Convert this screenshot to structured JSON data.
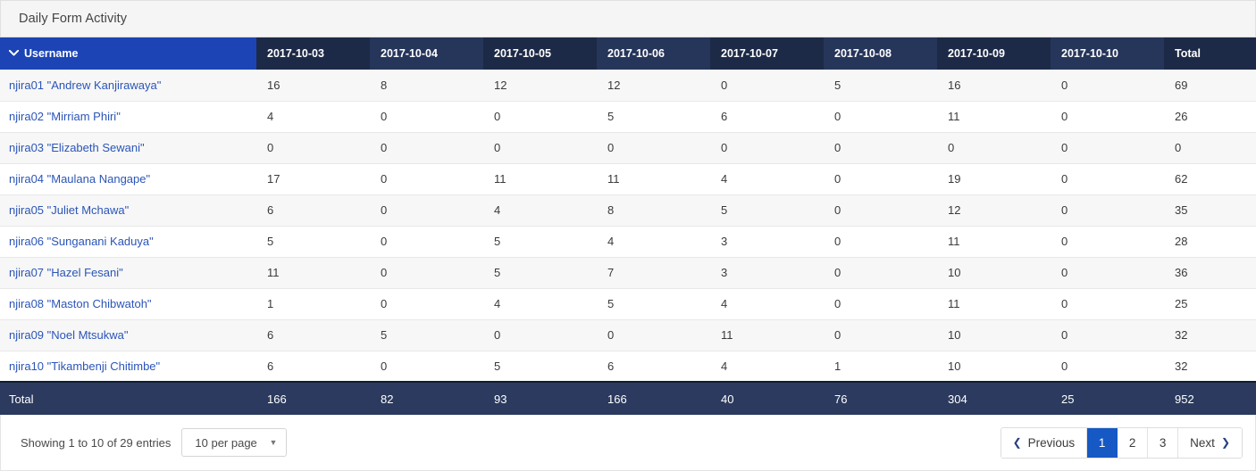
{
  "panel": {
    "title": "Daily Form Activity"
  },
  "table": {
    "username_header": "Username",
    "sort_icon": "chevron-down-icon",
    "sort_caret": "⌄",
    "date_headers": [
      "2017-10-03",
      "2017-10-04",
      "2017-10-05",
      "2017-10-06",
      "2017-10-07",
      "2017-10-08",
      "2017-10-09",
      "2017-10-10"
    ],
    "total_header": "Total",
    "rows": [
      {
        "username": "njira01 \"Andrew Kanjirawaya\"",
        "values": [
          "16",
          "8",
          "12",
          "12",
          "0",
          "5",
          "16",
          "0"
        ],
        "total": "69"
      },
      {
        "username": "njira02 \"Mirriam Phiri\"",
        "values": [
          "4",
          "0",
          "0",
          "5",
          "6",
          "0",
          "11",
          "0"
        ],
        "total": "26"
      },
      {
        "username": "njira03 \"Elizabeth Sewani\"",
        "values": [
          "0",
          "0",
          "0",
          "0",
          "0",
          "0",
          "0",
          "0"
        ],
        "total": "0"
      },
      {
        "username": "njira04 \"Maulana Nangape\"",
        "values": [
          "17",
          "0",
          "11",
          "11",
          "4",
          "0",
          "19",
          "0"
        ],
        "total": "62"
      },
      {
        "username": "njira05 \"Juliet Mchawa\"",
        "values": [
          "6",
          "0",
          "4",
          "8",
          "5",
          "0",
          "12",
          "0"
        ],
        "total": "35"
      },
      {
        "username": "njira06 \"Sunganani Kaduya\"",
        "values": [
          "5",
          "0",
          "5",
          "4",
          "3",
          "0",
          "11",
          "0"
        ],
        "total": "28"
      },
      {
        "username": "njira07 \"Hazel Fesani\"",
        "values": [
          "11",
          "0",
          "5",
          "7",
          "3",
          "0",
          "10",
          "0"
        ],
        "total": "36"
      },
      {
        "username": "njira08 \"Maston Chibwatoh\"",
        "values": [
          "1",
          "0",
          "4",
          "5",
          "4",
          "0",
          "11",
          "0"
        ],
        "total": "25"
      },
      {
        "username": "njira09 \"Noel Mtsukwa\"",
        "values": [
          "6",
          "5",
          "0",
          "0",
          "11",
          "0",
          "10",
          "0"
        ],
        "total": "32"
      },
      {
        "username": "njira10 \"Tikambenji Chitimbe\"",
        "values": [
          "6",
          "0",
          "5",
          "6",
          "4",
          "1",
          "10",
          "0"
        ],
        "total": "32"
      }
    ],
    "footer": {
      "label": "Total",
      "values": [
        "166",
        "82",
        "93",
        "166",
        "40",
        "76",
        "304",
        "25"
      ],
      "total": "952"
    }
  },
  "controls": {
    "entries_info": "Showing 1 to 10 of 29 entries",
    "per_page_value": "10 per page",
    "per_page_caret": "▼",
    "pagination": {
      "previous_label": "Previous",
      "previous_chevron": "❮",
      "next_label": "Next",
      "next_chevron": "❯",
      "pages": [
        "1",
        "2",
        "3"
      ],
      "active_page": "1"
    }
  },
  "colors": {
    "header_dark": "#1d2a47",
    "header_dark_alt": "#26355a",
    "username_header_blue": "#1c44b5",
    "footer_row": "#2b3a5e",
    "link_blue": "#2b55b7",
    "active_page_blue": "#1659c4"
  }
}
